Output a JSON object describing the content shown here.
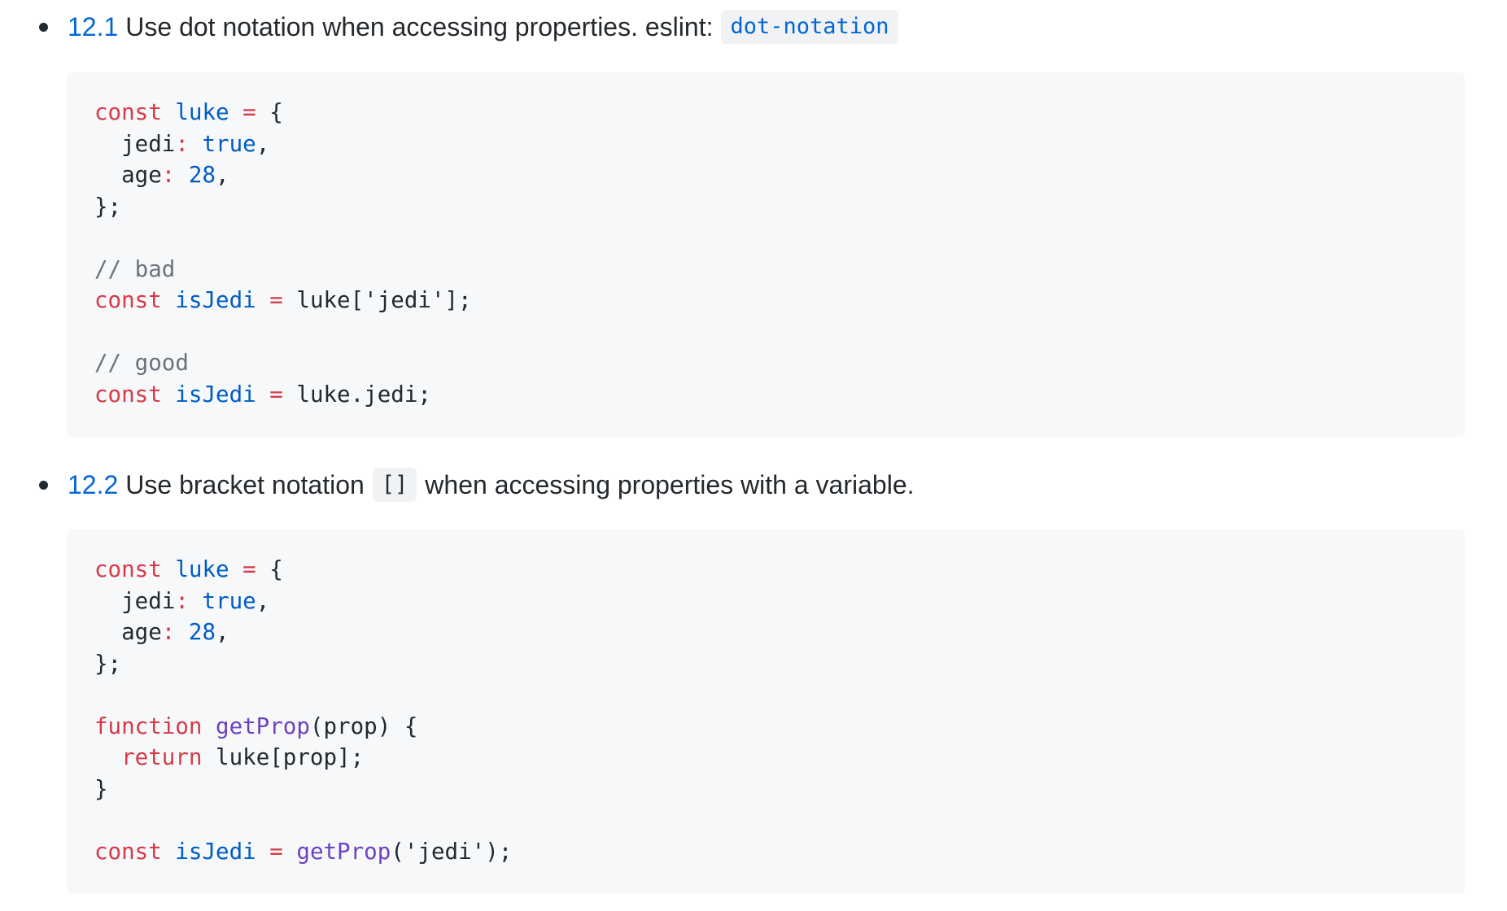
{
  "sections": [
    {
      "rule_number": "12.1",
      "text_before": "Use dot notation when accessing properties. eslint:",
      "code_chip": "dot-notation",
      "text_after": "",
      "code_lines": [
        [
          {
            "t": "kw",
            "v": "const"
          },
          {
            "t": "plain",
            "v": " "
          },
          {
            "t": "def",
            "v": "luke"
          },
          {
            "t": "plain",
            "v": " "
          },
          {
            "t": "kw",
            "v": "="
          },
          {
            "t": "plain",
            "v": " {"
          }
        ],
        [
          {
            "t": "plain",
            "v": "  jedi"
          },
          {
            "t": "kw",
            "v": ":"
          },
          {
            "t": "plain",
            "v": " "
          },
          {
            "t": "def",
            "v": "true"
          },
          {
            "t": "plain",
            "v": ","
          }
        ],
        [
          {
            "t": "plain",
            "v": "  age"
          },
          {
            "t": "kw",
            "v": ":"
          },
          {
            "t": "plain",
            "v": " "
          },
          {
            "t": "def",
            "v": "28"
          },
          {
            "t": "plain",
            "v": ","
          }
        ],
        [
          {
            "t": "plain",
            "v": "};"
          }
        ],
        [],
        [
          {
            "t": "com",
            "v": "// bad"
          }
        ],
        [
          {
            "t": "kw",
            "v": "const"
          },
          {
            "t": "plain",
            "v": " "
          },
          {
            "t": "def",
            "v": "isJedi"
          },
          {
            "t": "plain",
            "v": " "
          },
          {
            "t": "kw",
            "v": "="
          },
          {
            "t": "plain",
            "v": " luke['jedi'];"
          }
        ],
        [],
        [
          {
            "t": "com",
            "v": "// good"
          }
        ],
        [
          {
            "t": "kw",
            "v": "const"
          },
          {
            "t": "plain",
            "v": " "
          },
          {
            "t": "def",
            "v": "isJedi"
          },
          {
            "t": "plain",
            "v": " "
          },
          {
            "t": "kw",
            "v": "="
          },
          {
            "t": "plain",
            "v": " luke.jedi;"
          }
        ]
      ]
    },
    {
      "rule_number": "12.2",
      "text_before": "Use bracket notation",
      "code_chip": "[]",
      "text_after": "when accessing properties with a variable.",
      "code_lines": [
        [
          {
            "t": "kw",
            "v": "const"
          },
          {
            "t": "plain",
            "v": " "
          },
          {
            "t": "def",
            "v": "luke"
          },
          {
            "t": "plain",
            "v": " "
          },
          {
            "t": "kw",
            "v": "="
          },
          {
            "t": "plain",
            "v": " {"
          }
        ],
        [
          {
            "t": "plain",
            "v": "  jedi"
          },
          {
            "t": "kw",
            "v": ":"
          },
          {
            "t": "plain",
            "v": " "
          },
          {
            "t": "def",
            "v": "true"
          },
          {
            "t": "plain",
            "v": ","
          }
        ],
        [
          {
            "t": "plain",
            "v": "  age"
          },
          {
            "t": "kw",
            "v": ":"
          },
          {
            "t": "plain",
            "v": " "
          },
          {
            "t": "def",
            "v": "28"
          },
          {
            "t": "plain",
            "v": ","
          }
        ],
        [
          {
            "t": "plain",
            "v": "};"
          }
        ],
        [],
        [
          {
            "t": "kw",
            "v": "function"
          },
          {
            "t": "plain",
            "v": " "
          },
          {
            "t": "fn",
            "v": "getProp"
          },
          {
            "t": "plain",
            "v": "(prop) {"
          }
        ],
        [
          {
            "t": "plain",
            "v": "  "
          },
          {
            "t": "kw",
            "v": "return"
          },
          {
            "t": "plain",
            "v": " luke[prop];"
          }
        ],
        [
          {
            "t": "plain",
            "v": "}"
          }
        ],
        [],
        [
          {
            "t": "kw",
            "v": "const"
          },
          {
            "t": "plain",
            "v": " "
          },
          {
            "t": "def",
            "v": "isJedi"
          },
          {
            "t": "plain",
            "v": " "
          },
          {
            "t": "kw",
            "v": "="
          },
          {
            "t": "plain",
            "v": " "
          },
          {
            "t": "fn",
            "v": "getProp"
          },
          {
            "t": "plain",
            "v": "('jedi');"
          }
        ]
      ]
    }
  ]
}
